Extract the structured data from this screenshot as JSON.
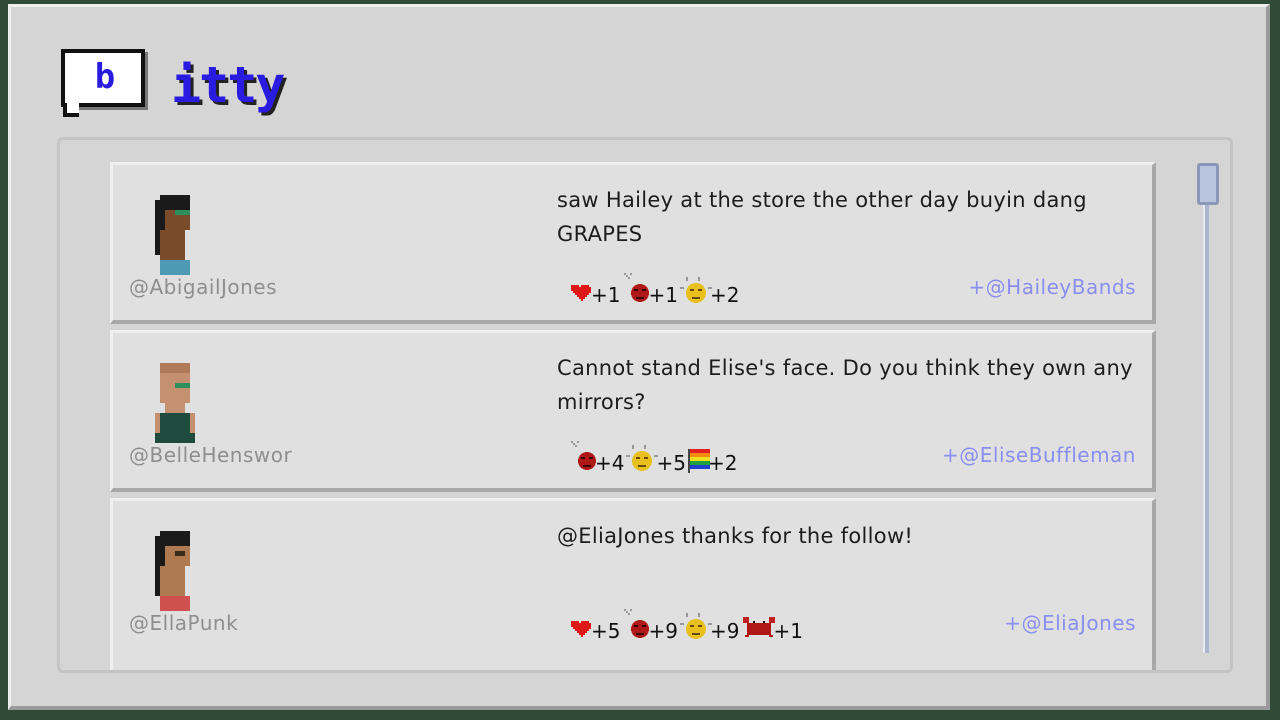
{
  "app": {
    "logo_word": "itty",
    "logo_letter": "b"
  },
  "posts": [
    {
      "handle": "@AbigailJones",
      "message": "saw Hailey at the store the other day buyin dang GRAPES",
      "mention": "+@HaileyBands",
      "reactions": [
        {
          "icon": "heart-icon",
          "count": "+1"
        },
        {
          "icon": "angry-icon",
          "count": "+1"
        },
        {
          "icon": "happy-icon",
          "count": "+2"
        }
      ]
    },
    {
      "handle": "@BelleHenswor",
      "message": "Cannot stand Elise's face. Do you think they own any mirrors?",
      "mention": "+@EliseBuffleman",
      "reactions": [
        {
          "icon": "angry-icon",
          "count": "+4"
        },
        {
          "icon": "happy-icon",
          "count": "+5"
        },
        {
          "icon": "rainbow-flag-icon",
          "count": "+2"
        }
      ]
    },
    {
      "handle": "@EllaPunk",
      "message": "@EliaJones thanks for the follow!",
      "mention": "+@EliaJones",
      "reactions": [
        {
          "icon": "heart-icon",
          "count": "+5"
        },
        {
          "icon": "angry-icon",
          "count": "+9"
        },
        {
          "icon": "happy-icon",
          "count": "+9"
        },
        {
          "icon": "crab-icon",
          "count": "+1"
        }
      ]
    }
  ],
  "colors": {
    "brand": "#2a1be0",
    "mention": "#8a8ef0",
    "handle": "#8e8e8e"
  }
}
